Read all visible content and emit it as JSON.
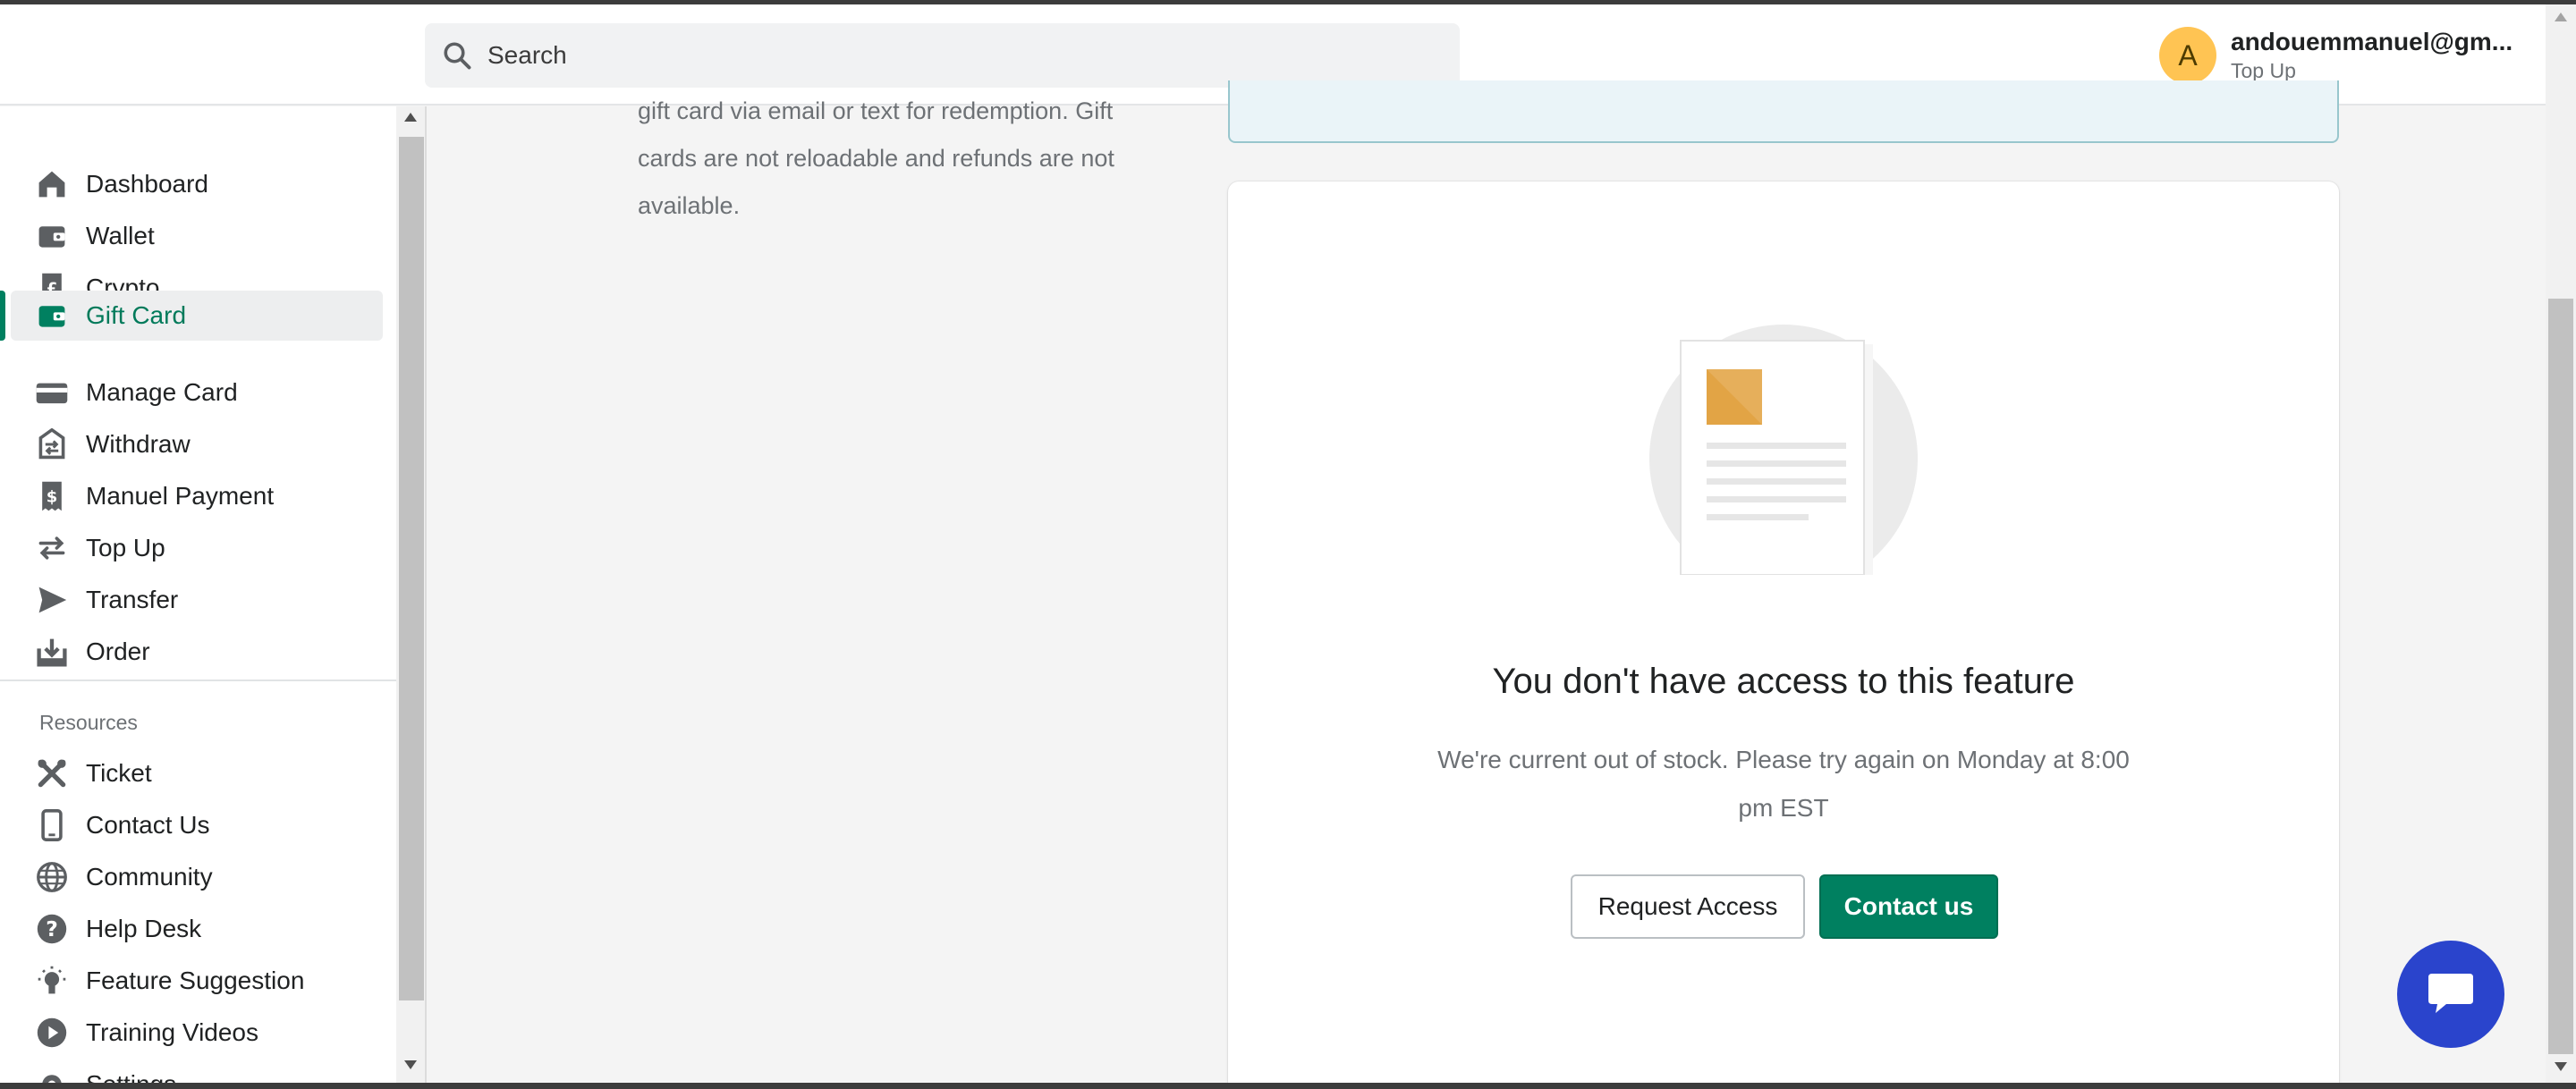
{
  "header": {
    "search_placeholder": "Search",
    "user_initial": "A",
    "user_email": "andouemmanuel@gm...",
    "user_subtitle": "Top Up"
  },
  "sidebar": {
    "items": [
      {
        "label": "Dashboard",
        "icon": "home-icon"
      },
      {
        "label": "Wallet",
        "icon": "wallet-icon"
      },
      {
        "label": "Crypto",
        "icon": "pound-receipt-icon"
      },
      {
        "label": "Gift Card",
        "icon": "gift-card-icon",
        "active": true
      },
      {
        "label": "Manage Card",
        "icon": "credit-card-icon"
      },
      {
        "label": "Withdraw",
        "icon": "withdraw-icon"
      },
      {
        "label": "Manuel Payment",
        "icon": "dollar-receipt-icon"
      },
      {
        "label": "Top Up",
        "icon": "arrows-swap-icon"
      },
      {
        "label": "Transfer",
        "icon": "send-icon"
      },
      {
        "label": "Order",
        "icon": "download-box-icon"
      }
    ],
    "resources_title": "Resources",
    "resources": [
      {
        "label": "Ticket",
        "icon": "tools-icon"
      },
      {
        "label": "Contact Us",
        "icon": "mobile-icon"
      },
      {
        "label": "Community",
        "icon": "globe-icon"
      },
      {
        "label": "Help Desk",
        "icon": "question-circle-icon"
      },
      {
        "label": "Feature Suggestion",
        "icon": "lightbulb-icon"
      },
      {
        "label": "Training Videos",
        "icon": "play-circle-icon"
      },
      {
        "label": "Settings",
        "icon": "gear-icon"
      }
    ]
  },
  "content": {
    "description_lines": [
      "gift card via email or text for redemption. Gift",
      "cards are not reloadable and refunds are not",
      "available."
    ],
    "empty_state": {
      "title": "You don't have access to this feature",
      "subtitle_line1": "We're current out of stock. Please try again on Monday at 8:00",
      "subtitle_line2": "pm EST",
      "secondary_button": "Request Access",
      "primary_button": "Contact us"
    }
  },
  "colors": {
    "accent": "#008060",
    "avatar": "#ffc453",
    "chat": "#2a44cc"
  }
}
